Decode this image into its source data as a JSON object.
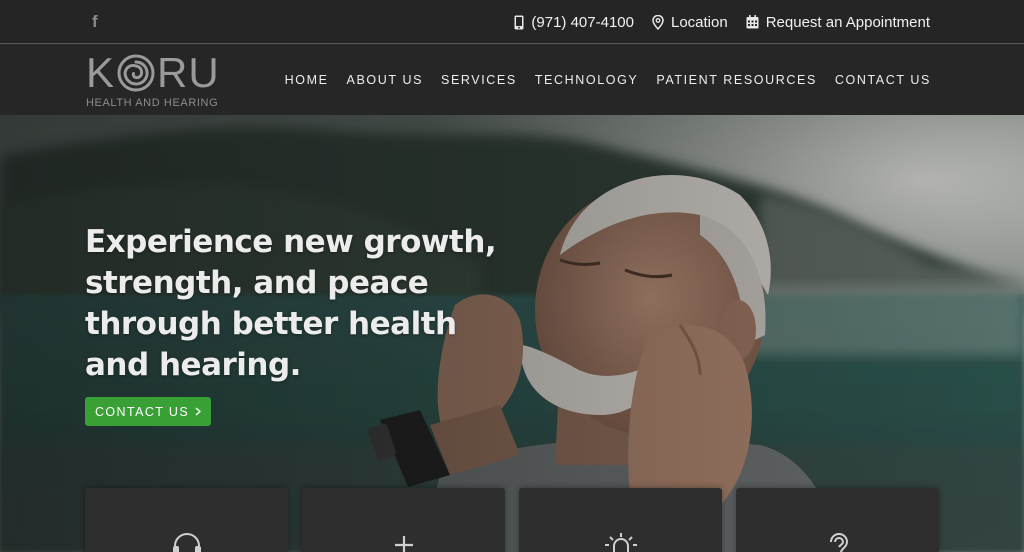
{
  "topbar": {
    "social_icon": "facebook-icon",
    "links": [
      {
        "icon": "phone-icon",
        "label": "(971) 407-4100"
      },
      {
        "icon": "map-pin-icon",
        "label": "Location"
      },
      {
        "icon": "calendar-icon",
        "label": "Request an Appointment"
      }
    ]
  },
  "logo": {
    "word_start": "K",
    "word_end": "RU",
    "tagline": "HEALTH AND HEARING"
  },
  "nav": {
    "items": [
      {
        "label": "HOME"
      },
      {
        "label": "ABOUT US"
      },
      {
        "label": "SERVICES"
      },
      {
        "label": "TECHNOLOGY"
      },
      {
        "label": "PATIENT RESOURCES"
      },
      {
        "label": "CONTACT US"
      }
    ]
  },
  "hero": {
    "headline": "Experience new growth, strength, and peace through better health and hearing.",
    "cta_label": "CONTACT US",
    "cta_icon": "chevron-right-icon"
  },
  "cards": [
    {
      "icon": "headphones-icon"
    },
    {
      "icon": "plus-icon"
    },
    {
      "icon": "alarm-light-icon"
    },
    {
      "icon": "ear-icon"
    }
  ],
  "colors": {
    "top_bar_bg": "#252525",
    "nav_bg": "#262626",
    "cta_green": "#39a035",
    "card_bg": "#2e2e2e"
  }
}
